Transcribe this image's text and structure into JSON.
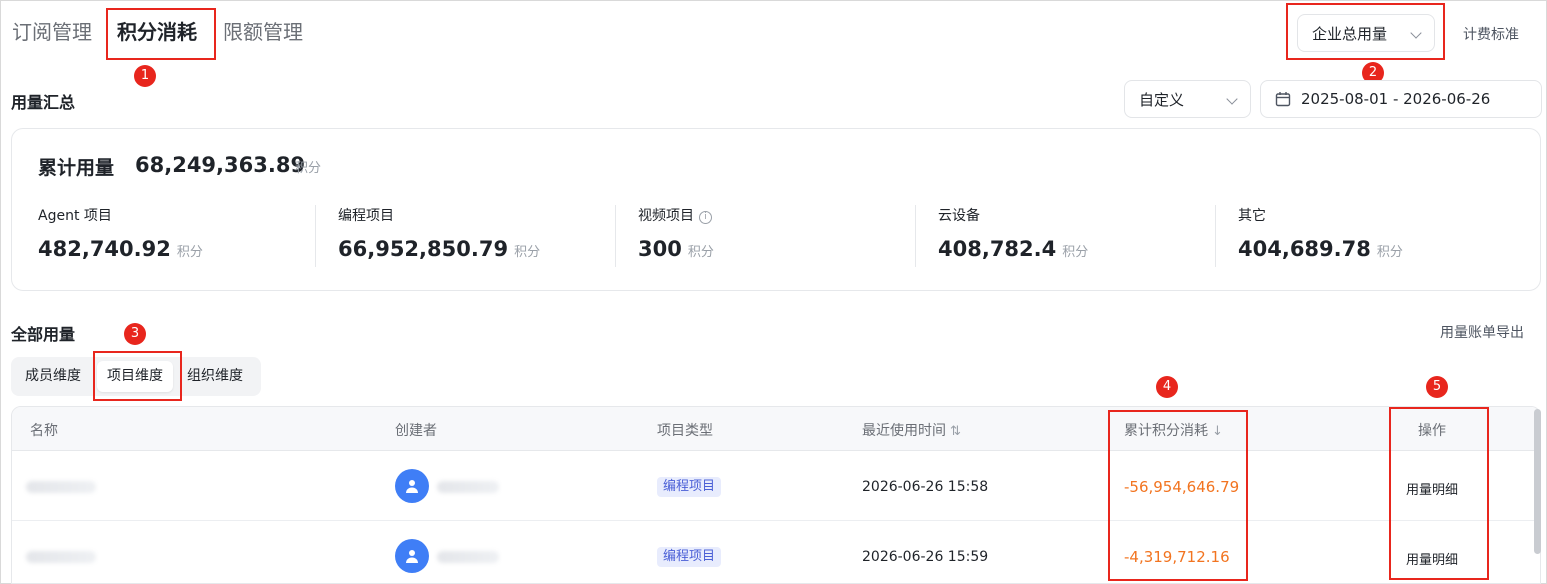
{
  "tabs": [
    "订阅管理",
    "积分消耗",
    "限额管理"
  ],
  "scope_select": "企业总用量",
  "billing_link": "计费标准",
  "summary": {
    "title": "用量汇总",
    "range_select": "自定义",
    "date_range": "2025-08-01 - 2026-06-26",
    "total_label": "累计用量",
    "total_value": "68,249,363.89",
    "unit": "积分",
    "metrics": [
      {
        "label": "Agent 项目",
        "value": "482,740.92"
      },
      {
        "label": "编程项目",
        "value": "66,952,850.79"
      },
      {
        "label": "视频项目",
        "value": "300"
      },
      {
        "label": "云设备",
        "value": "408,782.4"
      },
      {
        "label": "其它",
        "value": "404,689.78"
      }
    ]
  },
  "usage": {
    "title": "全部用量",
    "export_link": "用量账单导出",
    "dimensions": [
      "成员维度",
      "项目维度",
      "组织维度"
    ],
    "columns": [
      "名称",
      "创建者",
      "项目类型",
      "最近使用时间",
      "累计积分消耗",
      "操作"
    ],
    "rows": [
      {
        "type": "编程项目",
        "time": "2026-06-26 15:58",
        "credits": "-56,954,646.79",
        "action": "用量明细"
      },
      {
        "type": "编程项目",
        "time": "2026-06-26 15:59",
        "credits": "-4,319,712.16",
        "action": "用量明细"
      }
    ]
  },
  "annotations": [
    "1",
    "2",
    "3",
    "4",
    "5"
  ],
  "colors": {
    "accent_red": "#e8261d",
    "negative": "#f27420",
    "tag_bg": "#e8ecfd",
    "avatar": "#3f7ef6"
  }
}
